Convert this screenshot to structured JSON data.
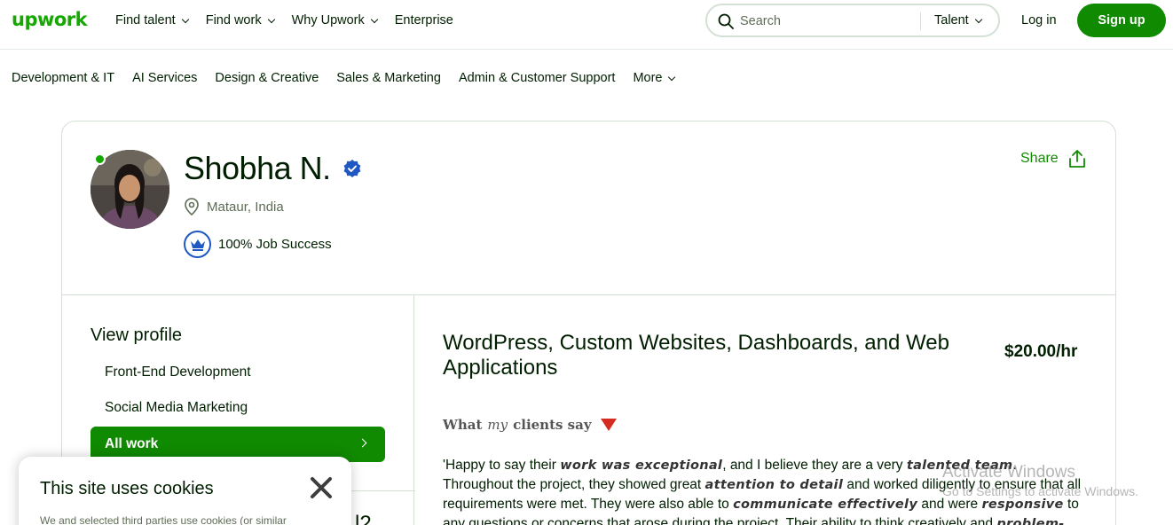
{
  "brand": {
    "logo_text": "upwork",
    "accent": "#14a800",
    "button_green": "#108a00"
  },
  "nav": {
    "links": [
      "Find talent",
      "Find work",
      "Why Upwork",
      "Enterprise"
    ],
    "search_placeholder": "Search",
    "search_type": "Talent",
    "login": "Log in",
    "signup": "Sign up"
  },
  "categories": [
    "Development & IT",
    "AI Services",
    "Design & Creative",
    "Sales & Marketing",
    "Admin & Customer Support",
    "More"
  ],
  "profile": {
    "name": "Shobha N.",
    "location": "Mataur, India",
    "job_success": "100% Job Success",
    "share": "Share",
    "online": true
  },
  "sidebar": {
    "heading": "View profile",
    "items": [
      "Front-End Development",
      "Social Media Marketing"
    ],
    "active": "All work",
    "peek_text": "l2"
  },
  "main": {
    "title": "WordPress, Custom Websites, Dashboards, and Web Applications",
    "rate": "$20.00/hr",
    "clients_say": {
      "pre": "What",
      "my": "my",
      "post": "clients say"
    },
    "review": {
      "t1": "'Happy to say their ",
      "b1": "work was exceptional",
      "t2": ", and I believe they are a very ",
      "b2": "talented team",
      "t3": ". Throughout the project, they showed great ",
      "b3": "attention to detail",
      "t4": " and worked diligently to ensure that all requirements were met. They were also able to ",
      "b4": "communicate effectively",
      "t5": " and were ",
      "b5": "responsive",
      "t6": " to any questions or concerns that arose during the project. Their ability to think creatively and ",
      "b6": "problem-"
    }
  },
  "watermark": {
    "line1": "Activate Windows",
    "line2": "Go to Settings to activate Windows."
  },
  "cookie": {
    "title": "This site uses cookies",
    "text": "We and selected third parties use cookies (or similar"
  }
}
